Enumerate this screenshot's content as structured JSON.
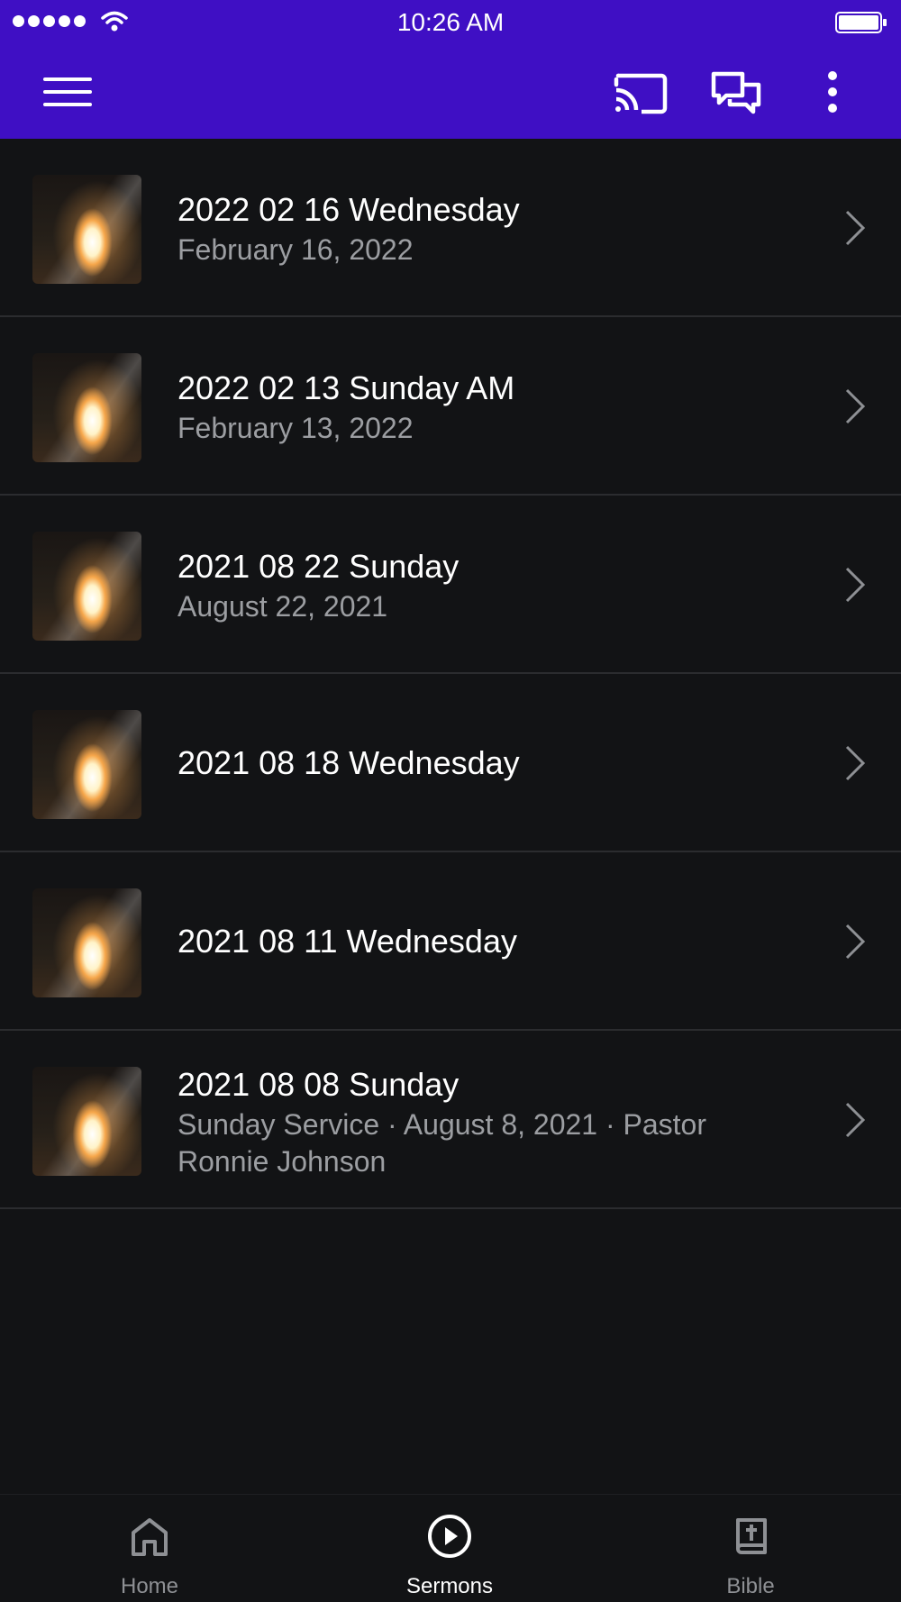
{
  "status_bar": {
    "time": "10:26 AM"
  },
  "sermons": [
    {
      "title": "2022 02 16 Wednesday",
      "subtitle": "February 16, 2022"
    },
    {
      "title": "2022 02 13 Sunday AM",
      "subtitle": "February 13, 2022"
    },
    {
      "title": "2021 08 22 Sunday",
      "subtitle": "August 22, 2021"
    },
    {
      "title": "2021 08 18 Wednesday",
      "subtitle": ""
    },
    {
      "title": "2021 08 11 Wednesday",
      "subtitle": ""
    },
    {
      "title": "2021 08 08 Sunday",
      "subtitle": "Sunday Service · August 8, 2021 · Pastor Ronnie Johnson"
    }
  ],
  "tabs": [
    {
      "label": "Home",
      "icon": "home-icon",
      "active": false
    },
    {
      "label": "Sermons",
      "icon": "play-circle-icon",
      "active": true
    },
    {
      "label": "Bible",
      "icon": "bible-icon",
      "active": false
    }
  ],
  "colors": {
    "app_bar": "#3f0fc4",
    "background": "#121315",
    "subtitle_text": "#9c9ea2",
    "active_tab": "#ffffff",
    "inactive_tab": "#8e9094"
  }
}
